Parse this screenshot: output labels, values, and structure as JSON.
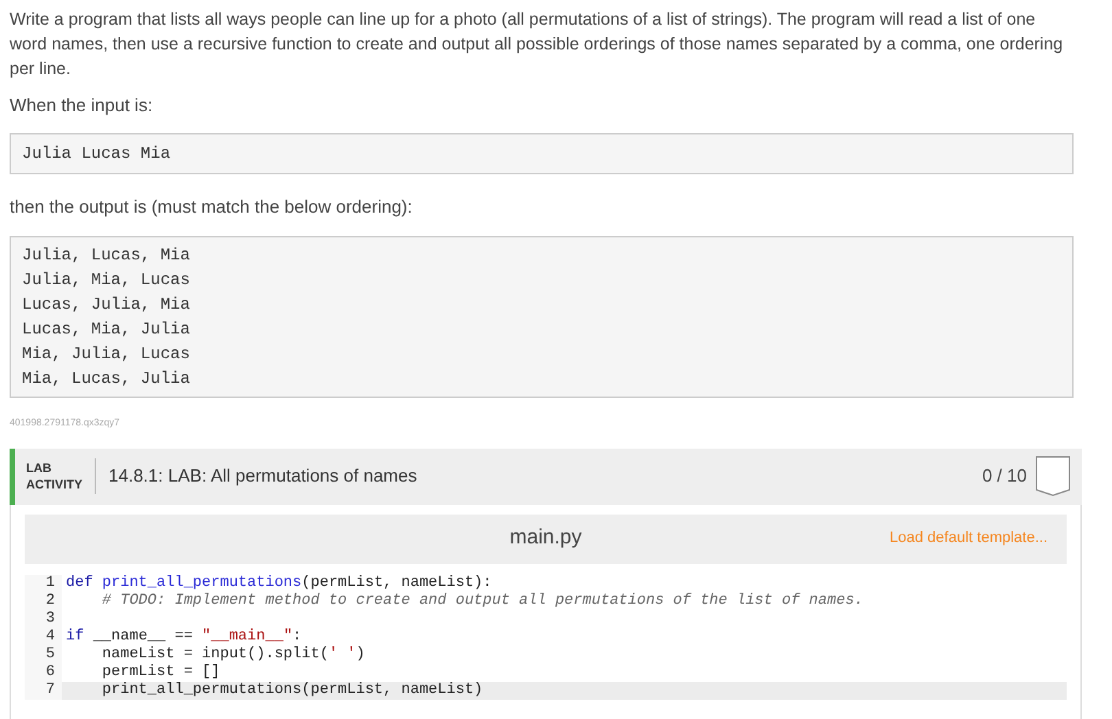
{
  "description": "Write a program that lists all ways people can line up for a photo (all permutations of a list of strings). The program will read a list of one word names, then use a recursive function to create and output all possible orderings of those names separated by a comma, one ordering per line.",
  "input_label": "When the input is:",
  "input_example": [
    "Julia Lucas Mia"
  ],
  "output_label": "then the output is (must match the below ordering):",
  "output_example": [
    "Julia, Lucas, Mia",
    "Julia, Mia, Lucas",
    "Lucas, Julia, Mia",
    "Lucas, Mia, Julia",
    "Mia, Julia, Lucas",
    "Mia, Lucas, Julia"
  ],
  "reference_id": "401998.2791178.qx3zqy7",
  "lab": {
    "tag": "LAB ACTIVITY",
    "title": "14.8.1: LAB: All permutations of names",
    "score": "0 / 10",
    "completed": false
  },
  "editor": {
    "filename": "main.py",
    "template_link": "Load default template...",
    "lines": [
      {
        "number": "1",
        "active": false,
        "tokens": [
          {
            "kind": "keyword",
            "text": "def "
          },
          {
            "kind": "function",
            "text": "print_all_permutations"
          },
          {
            "kind": "plain",
            "text": "(permList, nameList):"
          }
        ]
      },
      {
        "number": "2",
        "active": false,
        "tokens": [
          {
            "kind": "comment",
            "text": "    # TODO: Implement method to create and output all permutations of the list of names."
          }
        ]
      },
      {
        "number": "3",
        "active": false
      },
      {
        "number": "4",
        "active": false,
        "tokens": [
          {
            "kind": "keyword",
            "text": "if "
          },
          {
            "kind": "plain",
            "text": "__name__ == "
          },
          {
            "kind": "string",
            "text": "\"__main__\""
          },
          {
            "kind": "plain",
            "text": ":"
          }
        ]
      },
      {
        "number": "5",
        "active": false,
        "tokens": [
          {
            "kind": "plain",
            "text": "    nameList = input().split("
          },
          {
            "kind": "string",
            "text": "' '"
          },
          {
            "kind": "plain",
            "text": ")"
          }
        ]
      },
      {
        "number": "6",
        "active": false,
        "tokens": [
          {
            "kind": "plain",
            "text": "    permList = []"
          }
        ]
      },
      {
        "number": "7",
        "active": true,
        "tokens": [
          {
            "kind": "plain",
            "text": "    print_all_permutations(permList, nameList)"
          }
        ]
      }
    ]
  }
}
